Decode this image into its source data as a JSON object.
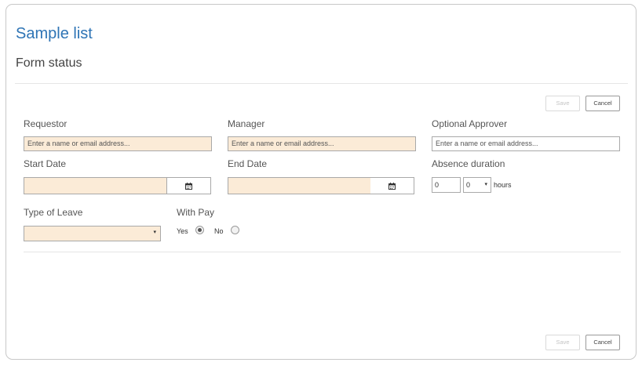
{
  "header": {
    "title": "Sample list",
    "subtitle": "Form status"
  },
  "toolbar": {
    "save_label": "Save",
    "cancel_label": "Cancel"
  },
  "footer": {
    "save_label": "Save",
    "cancel_label": "Cancel"
  },
  "form": {
    "requestor": {
      "label": "Requestor",
      "placeholder": "Enter a name or email address..."
    },
    "manager": {
      "label": "Manager",
      "placeholder": "Enter a name or email address..."
    },
    "optional_approver": {
      "label": "Optional Approver",
      "placeholder": "Enter a name or email address..."
    },
    "start_date": {
      "label": "Start Date",
      "value": ""
    },
    "end_date": {
      "label": "End Date",
      "value": ""
    },
    "absence_duration": {
      "label": "Absence duration",
      "value": "0",
      "hours_value": "0",
      "unit": "hours"
    },
    "type_of_leave": {
      "label": "Type of Leave",
      "value": ""
    },
    "with_pay": {
      "label": "With Pay",
      "options": [
        "Yes",
        "No"
      ],
      "selected": "Yes"
    }
  },
  "icons": {
    "calendar": "calendar-icon",
    "dropdown": "caret-down-icon"
  },
  "colors": {
    "title": "#2e74b5",
    "required_field_bg": "#fbebd7"
  }
}
